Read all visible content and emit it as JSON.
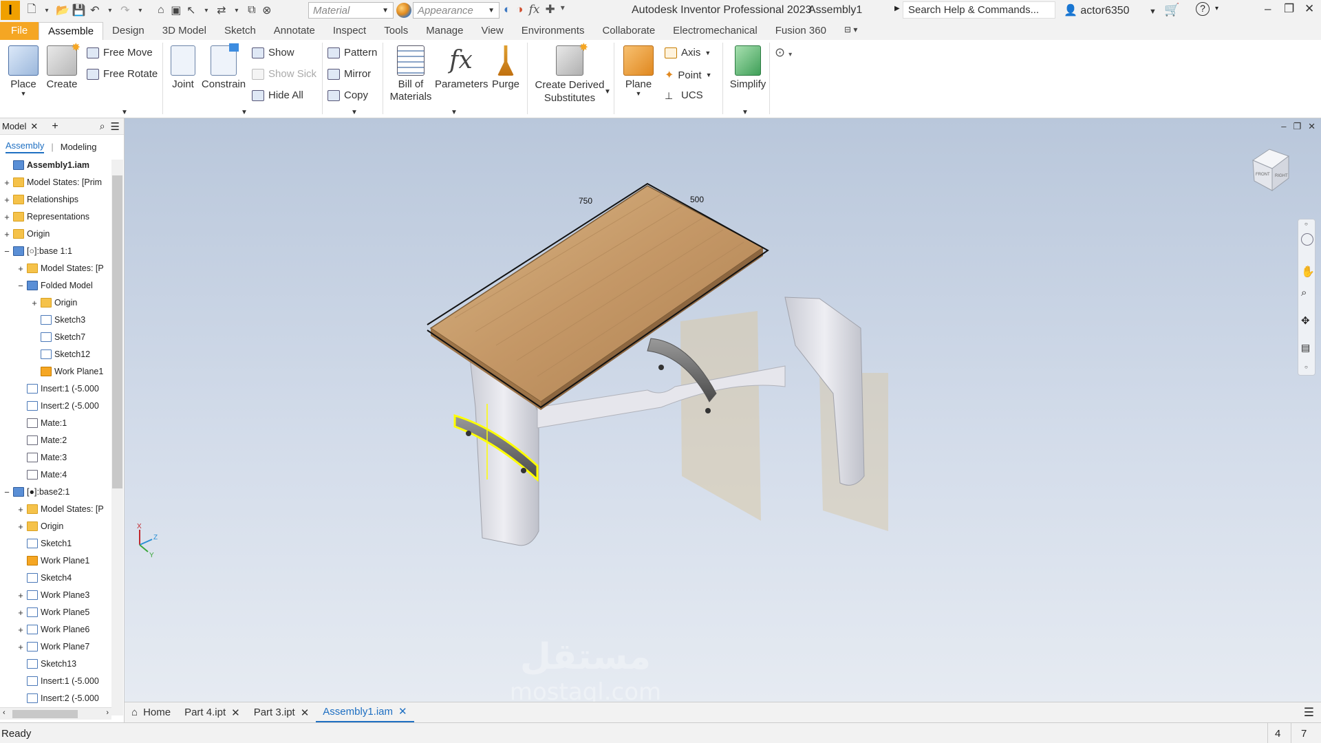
{
  "titlebar": {
    "material_placeholder": "Material",
    "appearance_placeholder": "Appearance",
    "app_title": "Autodesk Inventor Professional 2023",
    "doc_title": "Assembly1",
    "search_placeholder": "Search Help & Commands...",
    "user": "actor6350",
    "help": "?"
  },
  "tabs": [
    "File",
    "Assemble",
    "Design",
    "3D Model",
    "Sketch",
    "Annotate",
    "Inspect",
    "Tools",
    "Manage",
    "View",
    "Environments",
    "Collaborate",
    "Electromechanical",
    "Fusion 360"
  ],
  "ribbon": {
    "place": "Place",
    "create": "Create",
    "free_move": "Free Move",
    "free_rotate": "Free Rotate",
    "joint": "Joint",
    "constrain": "Constrain",
    "show": "Show",
    "show_sick": "Show Sick",
    "hide_all": "Hide All",
    "pattern": "Pattern",
    "mirror": "Mirror",
    "copy": "Copy",
    "bom1": "Bill of",
    "bom2": "Materials",
    "parameters": "Parameters",
    "purge": "Purge",
    "derived1": "Create Derived",
    "derived2": "Substitutes",
    "plane": "Plane",
    "axis": "Axis",
    "point": "Point",
    "ucs": "UCS",
    "simplify": "Simplify"
  },
  "browser": {
    "tab": "Model",
    "subtab_assembly": "Assembly",
    "subtab_modeling": "Modeling",
    "nodes": [
      {
        "label": "Assembly1.iam",
        "level": 0,
        "toggle": "",
        "icon": "part",
        "bold": true
      },
      {
        "label": "Model States: [Prim",
        "level": 0,
        "toggle": "+",
        "icon": "folder"
      },
      {
        "label": "Relationships",
        "level": 0,
        "toggle": "+",
        "icon": "folder"
      },
      {
        "label": "Representations",
        "level": 0,
        "toggle": "+",
        "icon": "folder"
      },
      {
        "label": "Origin",
        "level": 0,
        "toggle": "+",
        "icon": "folder"
      },
      {
        "label": "[○]:base 1:1",
        "level": 0,
        "toggle": "−",
        "icon": "part"
      },
      {
        "label": "Model States: [P",
        "level": 1,
        "toggle": "+",
        "icon": "folder"
      },
      {
        "label": "Folded Model",
        "level": 1,
        "toggle": "−",
        "icon": "part"
      },
      {
        "label": "Origin",
        "level": 2,
        "toggle": "+",
        "icon": "folder"
      },
      {
        "label": "Sketch3",
        "level": 2,
        "toggle": "",
        "icon": "sk"
      },
      {
        "label": "Sketch7",
        "level": 2,
        "toggle": "",
        "icon": "sk"
      },
      {
        "label": "Sketch12",
        "level": 2,
        "toggle": "",
        "icon": "sk"
      },
      {
        "label": "Work Plane1",
        "level": 2,
        "toggle": "",
        "icon": "wp"
      },
      {
        "label": "Insert:1 (-5.000",
        "level": 1,
        "toggle": "",
        "icon": "sk"
      },
      {
        "label": "Insert:2 (-5.000",
        "level": 1,
        "toggle": "",
        "icon": "sk"
      },
      {
        "label": "Mate:1",
        "level": 1,
        "toggle": "",
        "icon": "mate"
      },
      {
        "label": "Mate:2",
        "level": 1,
        "toggle": "",
        "icon": "mate"
      },
      {
        "label": "Mate:3",
        "level": 1,
        "toggle": "",
        "icon": "mate"
      },
      {
        "label": "Mate:4",
        "level": 1,
        "toggle": "",
        "icon": "mate"
      },
      {
        "label": "[●]:base2:1",
        "level": 0,
        "toggle": "−",
        "icon": "part"
      },
      {
        "label": "Model States: [P",
        "level": 1,
        "toggle": "+",
        "icon": "folder"
      },
      {
        "label": "Origin",
        "level": 1,
        "toggle": "+",
        "icon": "folder"
      },
      {
        "label": "Sketch1",
        "level": 1,
        "toggle": "",
        "icon": "sk"
      },
      {
        "label": "Work Plane1",
        "level": 1,
        "toggle": "",
        "icon": "wp"
      },
      {
        "label": "Sketch4",
        "level": 1,
        "toggle": "",
        "icon": "sk"
      },
      {
        "label": "Work Plane3",
        "level": 1,
        "toggle": "+",
        "icon": "sk"
      },
      {
        "label": "Work Plane5",
        "level": 1,
        "toggle": "+",
        "icon": "sk"
      },
      {
        "label": "Work Plane6",
        "level": 1,
        "toggle": "+",
        "icon": "sk"
      },
      {
        "label": "Work Plane7",
        "level": 1,
        "toggle": "+",
        "icon": "sk"
      },
      {
        "label": "Sketch13",
        "level": 1,
        "toggle": "",
        "icon": "sk"
      },
      {
        "label": "Insert:1 (-5.000",
        "level": 1,
        "toggle": "",
        "icon": "sk"
      },
      {
        "label": "Insert:2 (-5.000",
        "level": 1,
        "toggle": "",
        "icon": "sk"
      }
    ]
  },
  "viewport": {
    "dim_750": "750",
    "dim_500": "500",
    "watermark_ar": "مستقل",
    "watermark_en": "mostaql.com",
    "axis_x": "X",
    "axis_y": "Y",
    "axis_z": "Z",
    "viewcube_front": "FRONT",
    "viewcube_right": "RIGHT"
  },
  "doctabs": {
    "home": "Home",
    "tabs": [
      "Part 4.ipt",
      "Part 3.ipt",
      "Assembly1.iam"
    ],
    "active": "Assembly1.iam"
  },
  "status": {
    "text": "Ready",
    "count1": "4",
    "count2": "7"
  },
  "colors": {
    "accent": "#1e6fc2",
    "file_tab": "#f5a623",
    "wood": "#c9a06b",
    "selection": "#ffff00"
  }
}
